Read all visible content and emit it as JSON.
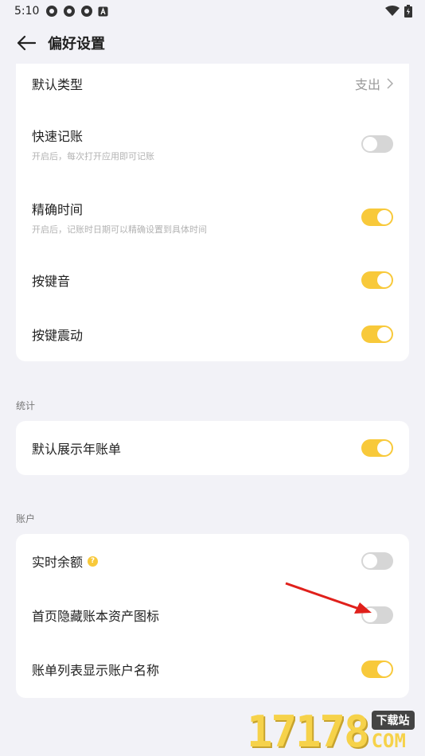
{
  "status": {
    "time": "5:10"
  },
  "header": {
    "title": "偏好设置"
  },
  "general": {
    "default_type": {
      "label": "默认类型",
      "value": "支出"
    },
    "quick_record": {
      "label": "快速记账",
      "desc": "开启后，每次打开应用即可记账",
      "on": false
    },
    "precise_time": {
      "label": "精确时间",
      "desc": "开启后，记账时日期可以精确设置到具体时间",
      "on": true
    },
    "key_sound": {
      "label": "按键音",
      "on": true
    },
    "key_vibrate": {
      "label": "按键震动",
      "on": true
    }
  },
  "stats": {
    "section": "统计",
    "default_year_bill": {
      "label": "默认展示年账单",
      "on": true
    }
  },
  "account": {
    "section": "账户",
    "realtime_balance": {
      "label": "实时余额",
      "help": "?",
      "on": false
    },
    "hide_asset_icon": {
      "label": "首页隐藏账本资产图标",
      "on": false
    },
    "show_account_name": {
      "label": "账单列表显示账户名称",
      "on": true
    }
  },
  "watermark": {
    "number": "17178",
    "badge": "下载站",
    "domain": "COM"
  },
  "colors": {
    "accent": "#f8c93a",
    "off": "#d6d6d6",
    "background": "#f2f2f7",
    "annotation": "#e0201b"
  }
}
